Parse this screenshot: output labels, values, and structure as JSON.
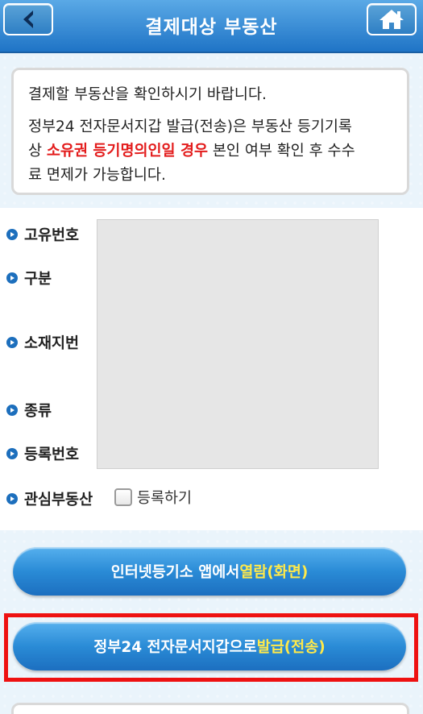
{
  "header": {
    "title": "결제대상 부동산",
    "back_icon": "back-arrow-icon",
    "home_icon": "home-icon"
  },
  "notice": {
    "line1": "결제할 부동산을 확인하시기 바랍니다.",
    "line2_a": "정부24 전자문서지갑 발급(전송)은 부동산 등기기록",
    "line2_b": "상 ",
    "line2_red": "소유권 등기명의인일 경우",
    "line2_c": " 본인 여부 확인 후 수수",
    "line2_d": "료 면제가 가능합니다."
  },
  "detail": {
    "labels": {
      "unique_no": "고유번호",
      "category": "구분",
      "address": "소재지번",
      "type": "종류",
      "reg_no": "등록번호",
      "interest": "관심부동산"
    },
    "register_label": "등록하기",
    "register_checked": false
  },
  "buttons": {
    "view_a": "인터넷등기소 앱에서 ",
    "view_b": "열람(화면)",
    "issue_a": "정부24 전자문서지갑으로 ",
    "issue_b": "발급(전송)"
  },
  "colors": {
    "header": "#1f74c6",
    "accent_red": "#e31c1c",
    "button_highlight": "#ffe94a",
    "selection_border": "#ee1111"
  }
}
